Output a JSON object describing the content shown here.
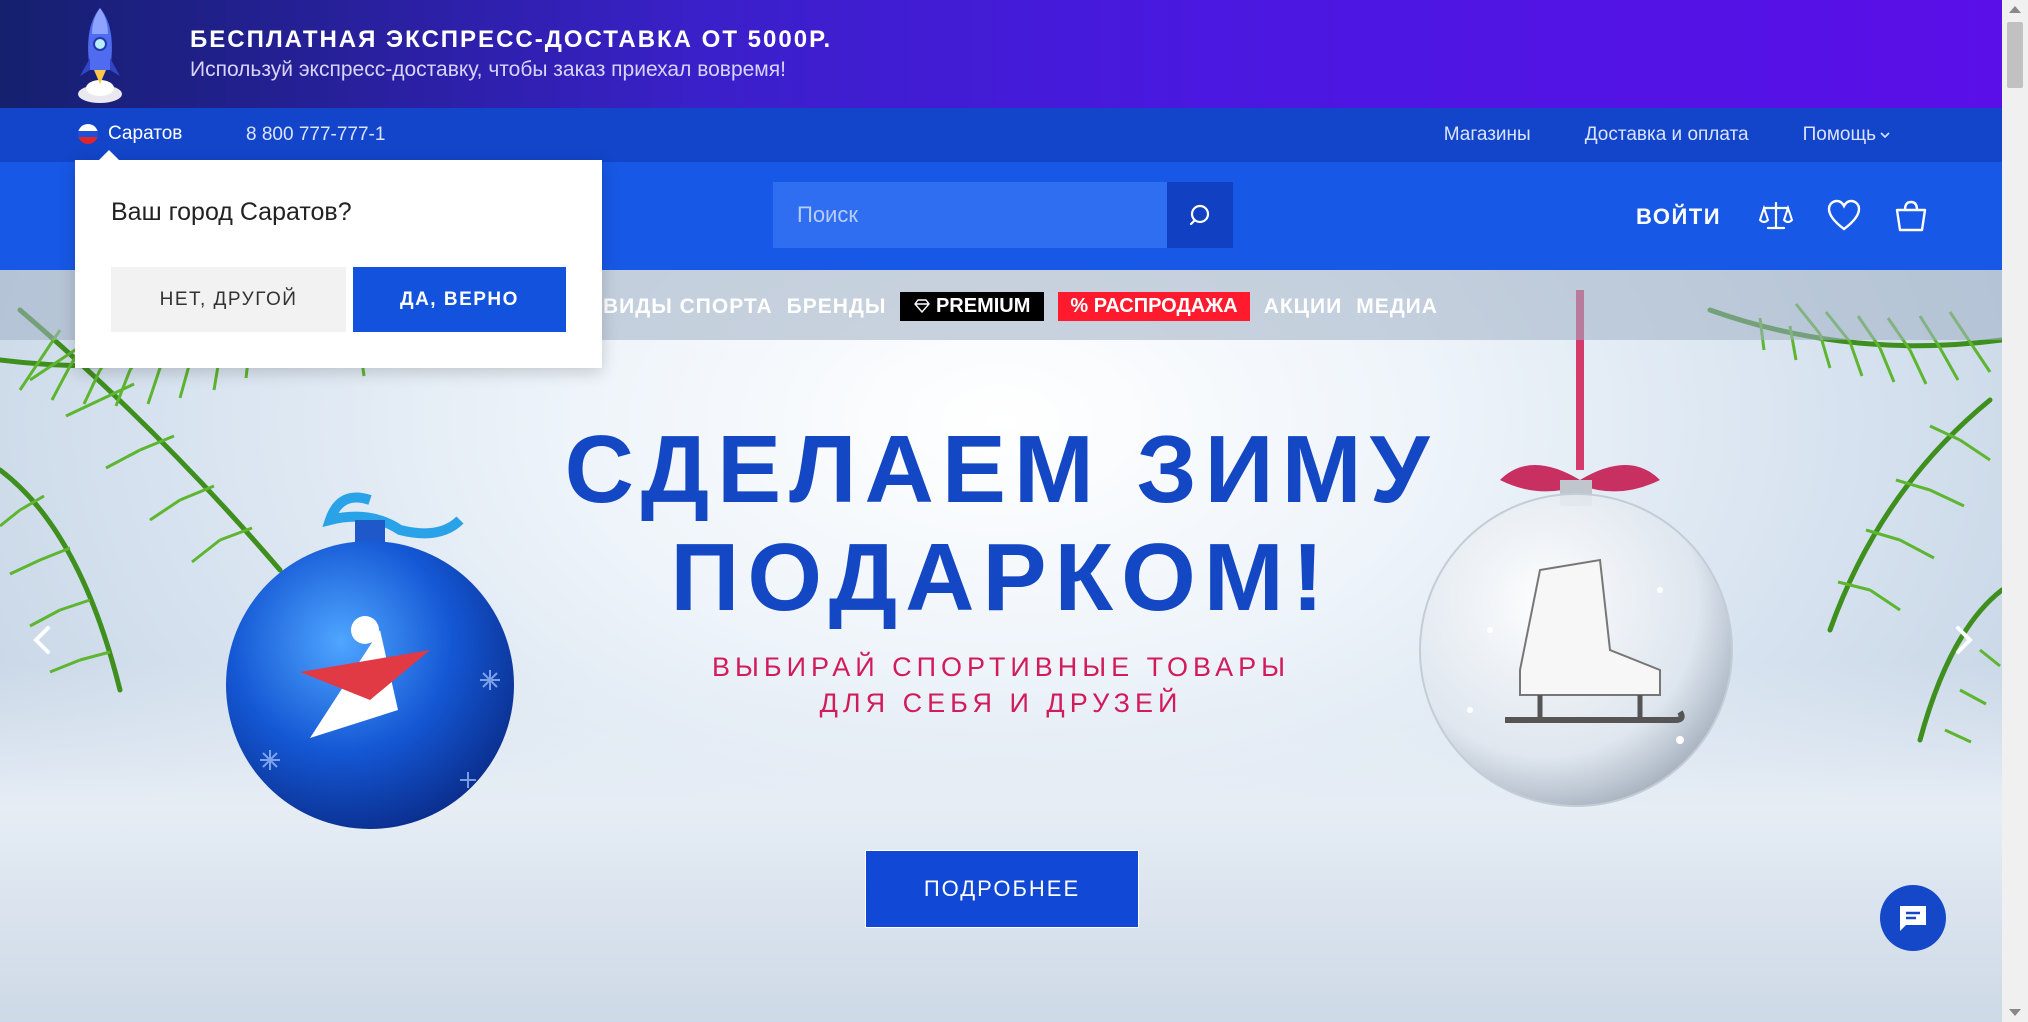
{
  "promo": {
    "title": "БЕСПЛАТНАЯ ЭКСПРЕСС-ДОСТАВКА ОТ 5000Р.",
    "subtitle": "Используй экспресс-доставку, чтобы заказ приехал вовремя!"
  },
  "topbar": {
    "city": "Саратов",
    "phone": "8 800 777-777-1",
    "links": [
      "Магазины",
      "Доставка и оплата",
      "Помощь"
    ]
  },
  "header": {
    "search_placeholder": "Поиск",
    "login": "ВОЙТИ"
  },
  "city_popup": {
    "question": "Ваш город Саратов?",
    "no_label": "НЕТ, ДРУГОЙ",
    "yes_label": "ДА, ВЕРНО"
  },
  "catnav": {
    "sports": "ВИДЫ СПОРТА",
    "brands": "БРЕНДЫ",
    "premium": "PREMIUM",
    "sale": "% РАСПРОДАЖА",
    "promos": "АКЦИИ",
    "media": "МЕДИА"
  },
  "hero": {
    "line1": "СДЕЛАЕМ ЗИМУ",
    "line2": "ПОДАРКОМ!",
    "tag1": "ВЫБИРАЙ СПОРТИВНЫЕ ТОВАРЫ",
    "tag2": "ДЛЯ СЕБЯ И ДРУЗЕЙ",
    "cta": "ПОДРОБНЕЕ"
  },
  "colors": {
    "brand_blue": "#1758e6",
    "topbar_blue": "#1245c9",
    "sale_red": "#ff1a2e",
    "tag_pink": "#d21b5a"
  }
}
